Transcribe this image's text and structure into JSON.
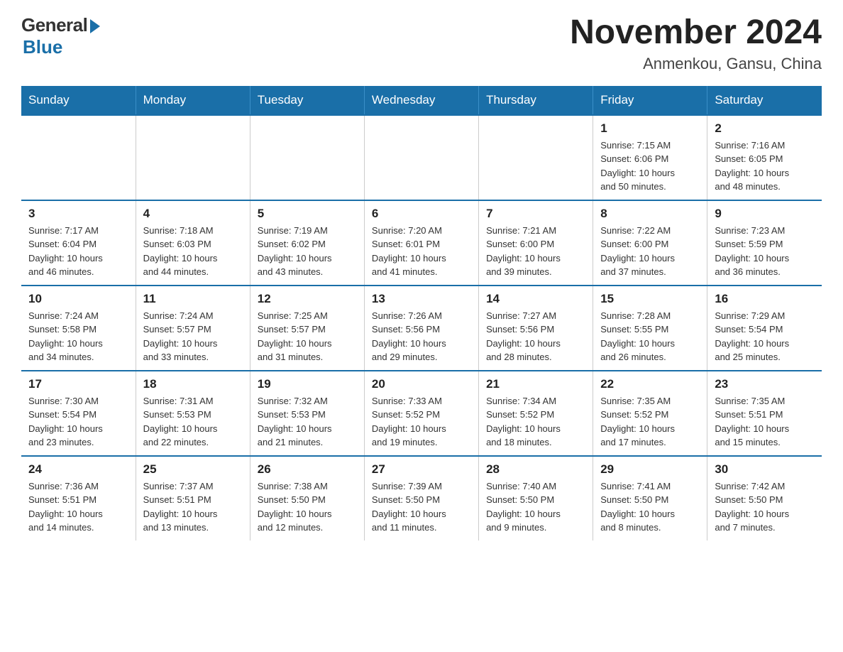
{
  "logo": {
    "general": "General",
    "blue": "Blue"
  },
  "title": "November 2024",
  "location": "Anmenkou, Gansu, China",
  "header": {
    "days": [
      "Sunday",
      "Monday",
      "Tuesday",
      "Wednesday",
      "Thursday",
      "Friday",
      "Saturday"
    ]
  },
  "weeks": [
    [
      {
        "day": "",
        "info": ""
      },
      {
        "day": "",
        "info": ""
      },
      {
        "day": "",
        "info": ""
      },
      {
        "day": "",
        "info": ""
      },
      {
        "day": "",
        "info": ""
      },
      {
        "day": "1",
        "info": "Sunrise: 7:15 AM\nSunset: 6:06 PM\nDaylight: 10 hours\nand 50 minutes."
      },
      {
        "day": "2",
        "info": "Sunrise: 7:16 AM\nSunset: 6:05 PM\nDaylight: 10 hours\nand 48 minutes."
      }
    ],
    [
      {
        "day": "3",
        "info": "Sunrise: 7:17 AM\nSunset: 6:04 PM\nDaylight: 10 hours\nand 46 minutes."
      },
      {
        "day": "4",
        "info": "Sunrise: 7:18 AM\nSunset: 6:03 PM\nDaylight: 10 hours\nand 44 minutes."
      },
      {
        "day": "5",
        "info": "Sunrise: 7:19 AM\nSunset: 6:02 PM\nDaylight: 10 hours\nand 43 minutes."
      },
      {
        "day": "6",
        "info": "Sunrise: 7:20 AM\nSunset: 6:01 PM\nDaylight: 10 hours\nand 41 minutes."
      },
      {
        "day": "7",
        "info": "Sunrise: 7:21 AM\nSunset: 6:00 PM\nDaylight: 10 hours\nand 39 minutes."
      },
      {
        "day": "8",
        "info": "Sunrise: 7:22 AM\nSunset: 6:00 PM\nDaylight: 10 hours\nand 37 minutes."
      },
      {
        "day": "9",
        "info": "Sunrise: 7:23 AM\nSunset: 5:59 PM\nDaylight: 10 hours\nand 36 minutes."
      }
    ],
    [
      {
        "day": "10",
        "info": "Sunrise: 7:24 AM\nSunset: 5:58 PM\nDaylight: 10 hours\nand 34 minutes."
      },
      {
        "day": "11",
        "info": "Sunrise: 7:24 AM\nSunset: 5:57 PM\nDaylight: 10 hours\nand 33 minutes."
      },
      {
        "day": "12",
        "info": "Sunrise: 7:25 AM\nSunset: 5:57 PM\nDaylight: 10 hours\nand 31 minutes."
      },
      {
        "day": "13",
        "info": "Sunrise: 7:26 AM\nSunset: 5:56 PM\nDaylight: 10 hours\nand 29 minutes."
      },
      {
        "day": "14",
        "info": "Sunrise: 7:27 AM\nSunset: 5:56 PM\nDaylight: 10 hours\nand 28 minutes."
      },
      {
        "day": "15",
        "info": "Sunrise: 7:28 AM\nSunset: 5:55 PM\nDaylight: 10 hours\nand 26 minutes."
      },
      {
        "day": "16",
        "info": "Sunrise: 7:29 AM\nSunset: 5:54 PM\nDaylight: 10 hours\nand 25 minutes."
      }
    ],
    [
      {
        "day": "17",
        "info": "Sunrise: 7:30 AM\nSunset: 5:54 PM\nDaylight: 10 hours\nand 23 minutes."
      },
      {
        "day": "18",
        "info": "Sunrise: 7:31 AM\nSunset: 5:53 PM\nDaylight: 10 hours\nand 22 minutes."
      },
      {
        "day": "19",
        "info": "Sunrise: 7:32 AM\nSunset: 5:53 PM\nDaylight: 10 hours\nand 21 minutes."
      },
      {
        "day": "20",
        "info": "Sunrise: 7:33 AM\nSunset: 5:52 PM\nDaylight: 10 hours\nand 19 minutes."
      },
      {
        "day": "21",
        "info": "Sunrise: 7:34 AM\nSunset: 5:52 PM\nDaylight: 10 hours\nand 18 minutes."
      },
      {
        "day": "22",
        "info": "Sunrise: 7:35 AM\nSunset: 5:52 PM\nDaylight: 10 hours\nand 17 minutes."
      },
      {
        "day": "23",
        "info": "Sunrise: 7:35 AM\nSunset: 5:51 PM\nDaylight: 10 hours\nand 15 minutes."
      }
    ],
    [
      {
        "day": "24",
        "info": "Sunrise: 7:36 AM\nSunset: 5:51 PM\nDaylight: 10 hours\nand 14 minutes."
      },
      {
        "day": "25",
        "info": "Sunrise: 7:37 AM\nSunset: 5:51 PM\nDaylight: 10 hours\nand 13 minutes."
      },
      {
        "day": "26",
        "info": "Sunrise: 7:38 AM\nSunset: 5:50 PM\nDaylight: 10 hours\nand 12 minutes."
      },
      {
        "day": "27",
        "info": "Sunrise: 7:39 AM\nSunset: 5:50 PM\nDaylight: 10 hours\nand 11 minutes."
      },
      {
        "day": "28",
        "info": "Sunrise: 7:40 AM\nSunset: 5:50 PM\nDaylight: 10 hours\nand 9 minutes."
      },
      {
        "day": "29",
        "info": "Sunrise: 7:41 AM\nSunset: 5:50 PM\nDaylight: 10 hours\nand 8 minutes."
      },
      {
        "day": "30",
        "info": "Sunrise: 7:42 AM\nSunset: 5:50 PM\nDaylight: 10 hours\nand 7 minutes."
      }
    ]
  ]
}
